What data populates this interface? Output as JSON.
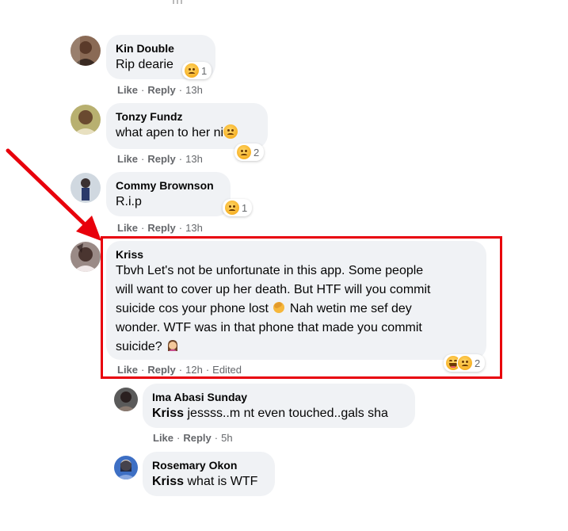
{
  "comments": [
    {
      "author": "Kin Double",
      "text": "Rip dearie",
      "reactions": {
        "types": [
          "sad"
        ],
        "count": "1"
      },
      "actions": {
        "like": "Like",
        "reply": "Reply",
        "time": "13h"
      },
      "avatar_color": "#7a5c4a"
    },
    {
      "author": "Tonzy Fundz",
      "text": "what apen to her ni",
      "reactions": {
        "types": [
          "sad"
        ],
        "count": "2"
      },
      "actions": {
        "like": "Like",
        "reply": "Reply",
        "time": "13h"
      },
      "avatar_color": "#8c9a4b"
    },
    {
      "author": "Commy Brownson",
      "text": "R.i.p",
      "reactions": {
        "types": [
          "sad"
        ],
        "count": "1"
      },
      "actions": {
        "like": "Like",
        "reply": "Reply",
        "time": "13h"
      },
      "avatar_color": "#5b6b7d"
    },
    {
      "author": "Kriss",
      "lines": [
        "Tbvh Let's not be unfortunate in this app. Some people",
        "will want to cover up her death. But HTF will you commit",
        "suicide cos your phone lost",
        "Nah wetin me sef dey",
        "wonder. WTF was in that phone that made you commit",
        "suicide?"
      ],
      "reactions": {
        "types": [
          "laugh",
          "sad"
        ],
        "count": "2"
      },
      "actions": {
        "like": "Like",
        "reply": "Reply",
        "time": "12h",
        "edited": "Edited"
      },
      "avatar_color": "#6d5a55"
    }
  ],
  "replies": [
    {
      "author": "Ima Abasi Sunday",
      "mention": "Kriss",
      "text": "jessss..m nt even touched..gals sha",
      "actions": {
        "like": "Like",
        "reply": "Reply",
        "time": "5h"
      },
      "avatar_color": "#4a4a4a"
    },
    {
      "author": "Rosemary Okon",
      "mention": "Kriss",
      "text": "what is WTF",
      "avatar_color": "#3d6fc4"
    }
  ],
  "colors": {
    "bubble": "#f0f2f5",
    "meta_text": "#65676b",
    "highlight": "#e8000b"
  }
}
